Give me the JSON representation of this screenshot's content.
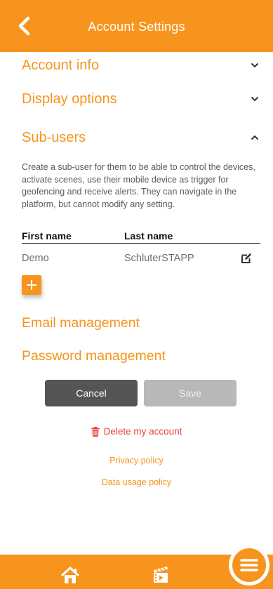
{
  "header": {
    "title": "Account Settings"
  },
  "sections": {
    "account_info": "Account info",
    "display_options": "Display options",
    "sub_users": "Sub-users"
  },
  "sub_users": {
    "description": "Create a sub-user for them to be able to control the devices, activate scenes, use their mobile device as trigger for geofencing and receive alerts. They can navigate in the platform, but cannot modify any setting.",
    "columns": [
      "First name",
      "Last name"
    ],
    "rows": [
      {
        "first_name": "Demo",
        "last_name": "SchluterSTAPP"
      }
    ]
  },
  "management": {
    "email": "Email management",
    "password": "Password management"
  },
  "actions": {
    "cancel": "Cancel",
    "save": "Save"
  },
  "links": {
    "delete_account": "Delete my account",
    "privacy_policy": "Privacy policy",
    "data_usage_policy": "Data usage policy"
  },
  "icons": {
    "back": "back-arrow-icon",
    "chevron_down": "chevron-down-icon",
    "chevron_up": "chevron-up-icon",
    "edit": "edit-icon",
    "add": "plus-icon",
    "trash": "trash-icon",
    "home": "home-icon",
    "scenes": "clapperboard-icon",
    "menu": "hamburger-menu-icon"
  },
  "colors": {
    "accent": "#F7941D",
    "danger": "#e2453b",
    "dark_button": "#555555",
    "disabled_button": "#b8b8b8"
  }
}
